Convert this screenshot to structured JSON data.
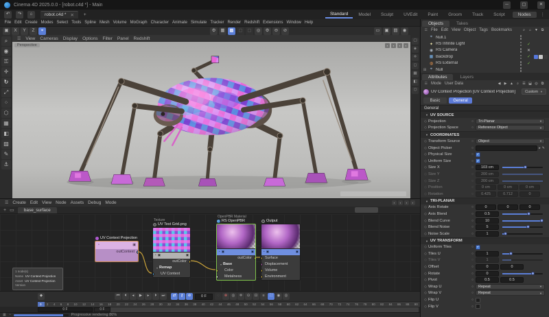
{
  "title_bar": {
    "title": "Cinema 4D 2025.0.0 - [robot.c4d *] - Main",
    "controls": [
      {
        "name": "minimize-button",
        "glyph": "─"
      },
      {
        "name": "maximize-button",
        "glyph": "▢"
      },
      {
        "name": "close-button",
        "glyph": "✕"
      }
    ]
  },
  "tab_row": {
    "nav_icons": [
      {
        "name": "undo-icon",
        "glyph": "↶"
      },
      {
        "name": "redo-icon",
        "glyph": "↷"
      },
      {
        "name": "home-icon",
        "glyph": "⌂"
      }
    ],
    "document_tab": {
      "label": "robot.c4d *",
      "close_glyph": "✕"
    },
    "add_tab_glyph": "+",
    "layout_tabs": [
      "Standard",
      "Model",
      "Sculpt",
      "UVEdit",
      "Paint",
      "Groom",
      "Track",
      "Script"
    ],
    "active_layout_tab": "Standard",
    "nodes_button": "Nodes",
    "more_glyph": "⋮"
  },
  "menu_bar": [
    "File",
    "Edit",
    "Create",
    "Modes",
    "Select",
    "Tools",
    "Spline",
    "Mesh",
    "Volume",
    "MoGraph",
    "Character",
    "Animate",
    "Simulate",
    "Tracker",
    "Render",
    "Redshift",
    "Extensions",
    "Window",
    "Help"
  ],
  "toolbar": {
    "left": [
      {
        "name": "workplane-icon",
        "glyph": "▣"
      },
      {
        "name": "lock-x-toggle",
        "glyph": "X"
      },
      {
        "name": "lock-y-toggle",
        "glyph": "Y"
      },
      {
        "name": "lock-z-toggle",
        "glyph": "Z"
      },
      {
        "name": "coordinate-system-toggle",
        "glyph": "⌖",
        "active": true
      }
    ],
    "center": [
      {
        "name": "modeling-settings-icon",
        "glyph": "⚙"
      },
      {
        "name": "snap-toggle",
        "glyph": "▦"
      },
      {
        "name": "quantize-toggle",
        "glyph": "▩",
        "active": true
      },
      {
        "name": "snap-option-a-icon",
        "glyph": "▢",
        "dim": true
      },
      {
        "name": "snap-option-b-icon",
        "glyph": "▢",
        "dim": true
      },
      {
        "name": "magnet-tool-icon",
        "glyph": "◎"
      },
      {
        "name": "magnet-settings-icon",
        "glyph": "⚙"
      },
      {
        "name": "axis-lock-icon",
        "glyph": "⊖"
      },
      {
        "name": "axis-band-icon",
        "glyph": "⊘"
      }
    ],
    "right": [
      {
        "name": "render-view-button",
        "glyph": "▭"
      },
      {
        "name": "render-region-button",
        "glyph": "▣"
      },
      {
        "name": "render-settings-button",
        "glyph": "▤"
      },
      {
        "name": "redshift-render-button",
        "glyph": "◉"
      }
    ]
  },
  "left_toolbar": [
    {
      "name": "live-selection-tool",
      "glyph": "⌕"
    },
    {
      "name": "tweak-tool",
      "glyph": "◉"
    },
    {
      "name": "lock-tool",
      "glyph": "⚿"
    },
    {
      "name": "move-tool",
      "glyph": "✛"
    },
    {
      "name": "rotate-tool",
      "glyph": "↻",
      "active": true
    },
    {
      "name": "scale-tool",
      "glyph": "⤢"
    },
    {
      "name": "points-mode-button",
      "glyph": "⁘"
    },
    {
      "name": "edges-mode-button",
      "glyph": "⬡"
    },
    {
      "name": "polygons-mode-button",
      "glyph": "▦"
    },
    {
      "name": "model-mode-button",
      "glyph": "◧"
    },
    {
      "name": "texture-mode-button",
      "glyph": "▨"
    },
    {
      "name": "workplane-mode-button",
      "glyph": "✎"
    },
    {
      "name": "snap-mode-button",
      "glyph": "⚓"
    }
  ],
  "side_toolbar": [
    {
      "name": "view-layout-icon",
      "glyph": "▢"
    },
    {
      "name": "view-single-icon",
      "glyph": "◈"
    },
    {
      "name": "view-move-icon",
      "glyph": "✛"
    },
    {
      "name": "view-frame-icon",
      "glyph": "◻"
    },
    {
      "name": "view-grid-icon",
      "glyph": "▦"
    },
    {
      "name": "view-shade-icon",
      "glyph": "◧"
    },
    {
      "name": "view-wire-icon",
      "glyph": "⬡"
    }
  ],
  "viewport": {
    "menu": [
      "View",
      "Cameras",
      "Display",
      "Options",
      "Filter",
      "Panel",
      "Redshift"
    ],
    "view_label": "Perspective",
    "corner_icons": [
      {
        "name": "viewport-pin-icon",
        "glyph": "▪"
      },
      {
        "name": "viewport-float-icon",
        "glyph": "▪"
      },
      {
        "name": "viewport-home-icon",
        "glyph": "▪"
      },
      {
        "name": "viewport-maximize-icon",
        "glyph": "▪"
      }
    ]
  },
  "node_editor": {
    "menu": [
      "Create",
      "Edit",
      "View",
      "Node",
      "Assets",
      "Debug",
      "Mode"
    ],
    "corner_icons": [
      {
        "name": "ne-dock-icon",
        "glyph": "▪"
      },
      {
        "name": "ne-float-icon",
        "glyph": "▪"
      },
      {
        "name": "ne-home-icon",
        "glyph": "▪"
      },
      {
        "name": "ne-maximize-icon",
        "glyph": "▪"
      }
    ],
    "tab_label": "base_surface",
    "nodes": {
      "uv_projection": {
        "title": "UV Context Projection",
        "out_port": "outContext",
        "port_color": "#4da6e8"
      },
      "texture": {
        "category": "Texture",
        "title": "UV Test Grid.png",
        "out_port": "outColor",
        "out_color": "#e8c341",
        "group": "Remap",
        "in_port": "UV Context",
        "in_color": "#4da6e8"
      },
      "material": {
        "category": "OpenPBR Material",
        "title": "RS OpenPBR",
        "out_port": "outColor",
        "out_color": "#e8c341",
        "group": "Base",
        "in_ports": [
          {
            "label": "Color",
            "color": "#e8c341"
          },
          {
            "label": "Metalness",
            "color": "#ffffff"
          }
        ]
      },
      "output": {
        "title": "Output",
        "in_ports": [
          {
            "label": "Surface",
            "color": "#e8c341"
          },
          {
            "label": "Displacement",
            "color": "#c96fc9"
          },
          {
            "label": "Volume",
            "color": "#e8c341"
          },
          {
            "label": "Environment",
            "color": "#e8c341"
          }
        ]
      }
    },
    "info_box": {
      "count": "1 node(s)",
      "rows": [
        [
          "Name",
          "UV Context Projection"
        ],
        [
          "Asset",
          "UV Context Projection"
        ],
        [
          "Version",
          ""
        ]
      ]
    }
  },
  "objects_panel": {
    "tabs": [
      "Objects",
      "Takes"
    ],
    "active_tab": "Objects",
    "menu": [
      "File",
      "Edit",
      "View",
      "Object",
      "Tags",
      "Bookmarks"
    ],
    "menu_icons": [
      {
        "name": "search-icon",
        "glyph": "⌕"
      },
      {
        "name": "home-icon",
        "glyph": "⌂"
      },
      {
        "name": "filter-icon",
        "glyph": "▼"
      },
      {
        "name": "bookmark-icon",
        "glyph": "⧉"
      }
    ],
    "items": [
      {
        "label": "Null.1",
        "icon": "null-icon",
        "glyph": "⌖",
        "color": "#9fb6d4",
        "state": ""
      },
      {
        "label": "RS Infinite Light",
        "icon": "light-icon",
        "glyph": "✦",
        "color": "#e8e0a8",
        "state": "check"
      },
      {
        "label": "RS Camera",
        "icon": "camera-icon",
        "glyph": "◉",
        "color": "#aab4c0",
        "state": "cross"
      },
      {
        "label": "Backdrop",
        "icon": "backdrop-icon",
        "glyph": "▦",
        "color": "#79b1e8",
        "state": "check",
        "tags": [
          "#5577dd",
          "#c8c8c8",
          "#3a3a3a"
        ]
      },
      {
        "label": "RS External",
        "icon": "external-icon",
        "glyph": "◍",
        "color": "#e0914f",
        "state": "check"
      },
      {
        "label": "Null",
        "icon": "null-icon",
        "glyph": "⌖",
        "color": "#9fb6d4",
        "state": "",
        "expander": true
      }
    ]
  },
  "attributes_panel": {
    "tabs": [
      "Attributes",
      "Layers"
    ],
    "active_tab": "Attributes",
    "menu": [
      "Mode",
      "User Data"
    ],
    "menu_icons": [
      {
        "name": "back-icon",
        "glyph": "◀"
      },
      {
        "name": "forward-icon",
        "glyph": "▶"
      },
      {
        "name": "up-icon",
        "glyph": "▲"
      },
      {
        "name": "search-icon",
        "glyph": "⌕"
      },
      {
        "name": "filter-icon",
        "glyph": "☰"
      },
      {
        "name": "lock-icon",
        "glyph": "⬓"
      },
      {
        "name": "pin-icon",
        "glyph": "◎"
      },
      {
        "name": "panel-icon",
        "glyph": "⧉"
      }
    ],
    "object_title": "UV Context Projection [UV Context Projection]",
    "preset_button": "Custom",
    "tab_buttons": [
      {
        "label": "Basic"
      },
      {
        "label": "General",
        "active": true
      }
    ],
    "section_label": "General",
    "groups": [
      {
        "header": "UV SOURCE",
        "rows": [
          {
            "label": "Projection",
            "type": "dropdown",
            "value": "Tri-Planar"
          },
          {
            "label": "Projection Space",
            "type": "dropdown",
            "value": "Reference Object"
          }
        ]
      },
      {
        "header": "COORDINATES",
        "rows": [
          {
            "label": "Transform Source",
            "type": "dropdown",
            "value": "Object"
          },
          {
            "label": "Object Picker",
            "type": "picker",
            "value": ""
          },
          {
            "label": "Physical Size",
            "type": "checkbox",
            "checked": true
          },
          {
            "label": "Uniform Size",
            "type": "checkbox",
            "checked": true
          },
          {
            "label": "Size X",
            "type": "slider",
            "value": "103 cm",
            "pct": 58
          },
          {
            "label": "Size Y",
            "type": "slider",
            "value": "200 cm",
            "pct": 100,
            "disabled": true
          },
          {
            "label": "Size Z",
            "type": "slider",
            "value": "200 cm",
            "pct": 100,
            "disabled": true
          },
          {
            "label": "Position",
            "type": "triple",
            "values": [
              "0 cm",
              "0 cm",
              "0 cm"
            ],
            "disabled": true
          },
          {
            "label": "Rotation",
            "type": "triple",
            "values": [
              "0.425",
              "0.712",
              "0"
            ],
            "disabled": true
          }
        ]
      },
      {
        "header": "TRI-PLANAR",
        "rows": [
          {
            "label": "Axis Rotate",
            "type": "triple",
            "values": [
              "0",
              "0",
              "0"
            ]
          },
          {
            "label": "Axis Blend",
            "type": "slider",
            "value": "0.5",
            "pct": 66
          },
          {
            "label": "Blend Curve",
            "type": "slider",
            "value": "10",
            "pct": 98
          },
          {
            "label": "Blend Noise",
            "type": "slider",
            "value": "5",
            "pct": 64
          },
          {
            "label": "Noise Scale",
            "type": "slider",
            "value": "1",
            "pct": 9
          }
        ]
      },
      {
        "header": "UV TRANSFORM",
        "rows": [
          {
            "label": "Uniform Tiles",
            "type": "checkbox",
            "checked": true
          },
          {
            "label": "Tiles U",
            "type": "slider",
            "value": "1",
            "pct": 22
          },
          {
            "label": "Tiles V",
            "type": "slider",
            "value": "1",
            "pct": 22,
            "disabled": true
          },
          {
            "label": "Offset",
            "type": "double",
            "values": [
              "0",
              "0"
            ]
          },
          {
            "label": "Rotate",
            "type": "slider",
            "value": "0",
            "pct": 76
          },
          {
            "label": "Pivot",
            "type": "double",
            "values": [
              "0.5",
              "0.5"
            ]
          },
          {
            "label": "Wrap U",
            "type": "dropdown",
            "value": "Repeat"
          },
          {
            "label": "Wrap V",
            "type": "dropdown",
            "value": "Repeat"
          },
          {
            "label": "Flip U",
            "type": "checkbox",
            "checked": false
          },
          {
            "label": "Flip V",
            "type": "checkbox",
            "checked": false
          }
        ]
      }
    ]
  },
  "timeline": {
    "key_button": [
      {
        "name": "add-keyframe-button",
        "glyph": "◆"
      }
    ],
    "buttons": [
      {
        "name": "goto-start-button",
        "glyph": "⏮"
      },
      {
        "name": "prev-key-button",
        "glyph": "⏴"
      },
      {
        "name": "prev-frame-button",
        "glyph": "◂"
      },
      {
        "name": "play-button",
        "glyph": "▶"
      },
      {
        "name": "next-frame-button",
        "glyph": "▸"
      },
      {
        "name": "next-key-button",
        "glyph": "⏵"
      },
      {
        "name": "goto-end-button",
        "glyph": "⏭"
      }
    ],
    "toggles": [
      {
        "name": "keying-mode-toggle",
        "glyph": "⇄",
        "active": true
      },
      {
        "name": "keying-lock-toggle",
        "glyph": "⚷",
        "active": true
      },
      {
        "name": "keying-mute-toggle",
        "glyph": "⊘",
        "active": true
      }
    ],
    "frame_field": "0 F",
    "record_buttons": [
      {
        "name": "record-button",
        "glyph": "◌",
        "dim": true
      },
      {
        "name": "autokey-button",
        "glyph": "⊗",
        "red": true
      },
      {
        "name": "keyframe-selection-button",
        "glyph": "◎"
      },
      {
        "name": "key-position-toggle",
        "glyph": "✛"
      },
      {
        "name": "key-rotation-toggle",
        "glyph": "⊙"
      },
      {
        "name": "key-scale-toggle",
        "glyph": "⊡"
      },
      {
        "name": "key-parameter-toggle",
        "glyph": "≡"
      },
      {
        "name": "key-pla-toggle",
        "glyph": "⛶",
        "active": true
      },
      {
        "name": "sound-toggle",
        "glyph": "◉"
      },
      {
        "name": "loop-toggle",
        "glyph": "◎"
      }
    ],
    "ruler": {
      "start": 0,
      "end": 90,
      "step": 2,
      "playhead": 0
    },
    "range_fields": [
      "0 F",
      "0 F"
    ]
  },
  "status_bar": {
    "icons": [
      {
        "name": "grid-status-icon",
        "glyph": "▦"
      },
      {
        "name": "redshift-status-icon",
        "glyph": "◔"
      }
    ],
    "progress_pct": 90,
    "text": "Progressive rendering 86%"
  }
}
